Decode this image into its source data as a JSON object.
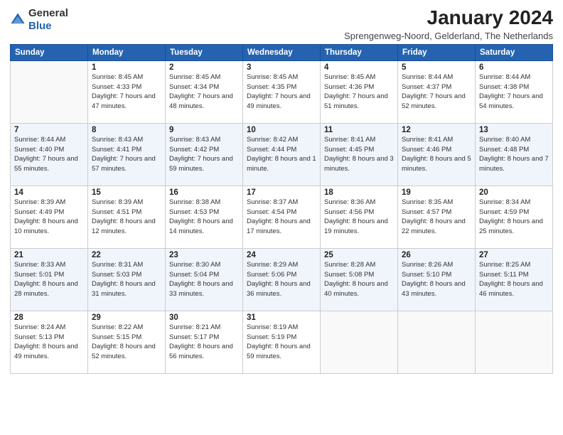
{
  "header": {
    "logo_general": "General",
    "logo_blue": "Blue",
    "title": "January 2024",
    "location": "Sprengenweg-Noord, Gelderland, The Netherlands"
  },
  "weekdays": [
    "Sunday",
    "Monday",
    "Tuesday",
    "Wednesday",
    "Thursday",
    "Friday",
    "Saturday"
  ],
  "weeks": [
    [
      {
        "num": "",
        "sunrise": "",
        "sunset": "",
        "daylight": ""
      },
      {
        "num": "1",
        "sunrise": "Sunrise: 8:45 AM",
        "sunset": "Sunset: 4:33 PM",
        "daylight": "Daylight: 7 hours and 47 minutes."
      },
      {
        "num": "2",
        "sunrise": "Sunrise: 8:45 AM",
        "sunset": "Sunset: 4:34 PM",
        "daylight": "Daylight: 7 hours and 48 minutes."
      },
      {
        "num": "3",
        "sunrise": "Sunrise: 8:45 AM",
        "sunset": "Sunset: 4:35 PM",
        "daylight": "Daylight: 7 hours and 49 minutes."
      },
      {
        "num": "4",
        "sunrise": "Sunrise: 8:45 AM",
        "sunset": "Sunset: 4:36 PM",
        "daylight": "Daylight: 7 hours and 51 minutes."
      },
      {
        "num": "5",
        "sunrise": "Sunrise: 8:44 AM",
        "sunset": "Sunset: 4:37 PM",
        "daylight": "Daylight: 7 hours and 52 minutes."
      },
      {
        "num": "6",
        "sunrise": "Sunrise: 8:44 AM",
        "sunset": "Sunset: 4:38 PM",
        "daylight": "Daylight: 7 hours and 54 minutes."
      }
    ],
    [
      {
        "num": "7",
        "sunrise": "Sunrise: 8:44 AM",
        "sunset": "Sunset: 4:40 PM",
        "daylight": "Daylight: 7 hours and 55 minutes."
      },
      {
        "num": "8",
        "sunrise": "Sunrise: 8:43 AM",
        "sunset": "Sunset: 4:41 PM",
        "daylight": "Daylight: 7 hours and 57 minutes."
      },
      {
        "num": "9",
        "sunrise": "Sunrise: 8:43 AM",
        "sunset": "Sunset: 4:42 PM",
        "daylight": "Daylight: 7 hours and 59 minutes."
      },
      {
        "num": "10",
        "sunrise": "Sunrise: 8:42 AM",
        "sunset": "Sunset: 4:44 PM",
        "daylight": "Daylight: 8 hours and 1 minute."
      },
      {
        "num": "11",
        "sunrise": "Sunrise: 8:41 AM",
        "sunset": "Sunset: 4:45 PM",
        "daylight": "Daylight: 8 hours and 3 minutes."
      },
      {
        "num": "12",
        "sunrise": "Sunrise: 8:41 AM",
        "sunset": "Sunset: 4:46 PM",
        "daylight": "Daylight: 8 hours and 5 minutes."
      },
      {
        "num": "13",
        "sunrise": "Sunrise: 8:40 AM",
        "sunset": "Sunset: 4:48 PM",
        "daylight": "Daylight: 8 hours and 7 minutes."
      }
    ],
    [
      {
        "num": "14",
        "sunrise": "Sunrise: 8:39 AM",
        "sunset": "Sunset: 4:49 PM",
        "daylight": "Daylight: 8 hours and 10 minutes."
      },
      {
        "num": "15",
        "sunrise": "Sunrise: 8:39 AM",
        "sunset": "Sunset: 4:51 PM",
        "daylight": "Daylight: 8 hours and 12 minutes."
      },
      {
        "num": "16",
        "sunrise": "Sunrise: 8:38 AM",
        "sunset": "Sunset: 4:53 PM",
        "daylight": "Daylight: 8 hours and 14 minutes."
      },
      {
        "num": "17",
        "sunrise": "Sunrise: 8:37 AM",
        "sunset": "Sunset: 4:54 PM",
        "daylight": "Daylight: 8 hours and 17 minutes."
      },
      {
        "num": "18",
        "sunrise": "Sunrise: 8:36 AM",
        "sunset": "Sunset: 4:56 PM",
        "daylight": "Daylight: 8 hours and 19 minutes."
      },
      {
        "num": "19",
        "sunrise": "Sunrise: 8:35 AM",
        "sunset": "Sunset: 4:57 PM",
        "daylight": "Daylight: 8 hours and 22 minutes."
      },
      {
        "num": "20",
        "sunrise": "Sunrise: 8:34 AM",
        "sunset": "Sunset: 4:59 PM",
        "daylight": "Daylight: 8 hours and 25 minutes."
      }
    ],
    [
      {
        "num": "21",
        "sunrise": "Sunrise: 8:33 AM",
        "sunset": "Sunset: 5:01 PM",
        "daylight": "Daylight: 8 hours and 28 minutes."
      },
      {
        "num": "22",
        "sunrise": "Sunrise: 8:31 AM",
        "sunset": "Sunset: 5:03 PM",
        "daylight": "Daylight: 8 hours and 31 minutes."
      },
      {
        "num": "23",
        "sunrise": "Sunrise: 8:30 AM",
        "sunset": "Sunset: 5:04 PM",
        "daylight": "Daylight: 8 hours and 33 minutes."
      },
      {
        "num": "24",
        "sunrise": "Sunrise: 8:29 AM",
        "sunset": "Sunset: 5:06 PM",
        "daylight": "Daylight: 8 hours and 36 minutes."
      },
      {
        "num": "25",
        "sunrise": "Sunrise: 8:28 AM",
        "sunset": "Sunset: 5:08 PM",
        "daylight": "Daylight: 8 hours and 40 minutes."
      },
      {
        "num": "26",
        "sunrise": "Sunrise: 8:26 AM",
        "sunset": "Sunset: 5:10 PM",
        "daylight": "Daylight: 8 hours and 43 minutes."
      },
      {
        "num": "27",
        "sunrise": "Sunrise: 8:25 AM",
        "sunset": "Sunset: 5:11 PM",
        "daylight": "Daylight: 8 hours and 46 minutes."
      }
    ],
    [
      {
        "num": "28",
        "sunrise": "Sunrise: 8:24 AM",
        "sunset": "Sunset: 5:13 PM",
        "daylight": "Daylight: 8 hours and 49 minutes."
      },
      {
        "num": "29",
        "sunrise": "Sunrise: 8:22 AM",
        "sunset": "Sunset: 5:15 PM",
        "daylight": "Daylight: 8 hours and 52 minutes."
      },
      {
        "num": "30",
        "sunrise": "Sunrise: 8:21 AM",
        "sunset": "Sunset: 5:17 PM",
        "daylight": "Daylight: 8 hours and 56 minutes."
      },
      {
        "num": "31",
        "sunrise": "Sunrise: 8:19 AM",
        "sunset": "Sunset: 5:19 PM",
        "daylight": "Daylight: 8 hours and 59 minutes."
      },
      {
        "num": "",
        "sunrise": "",
        "sunset": "",
        "daylight": ""
      },
      {
        "num": "",
        "sunrise": "",
        "sunset": "",
        "daylight": ""
      },
      {
        "num": "",
        "sunrise": "",
        "sunset": "",
        "daylight": ""
      }
    ]
  ]
}
